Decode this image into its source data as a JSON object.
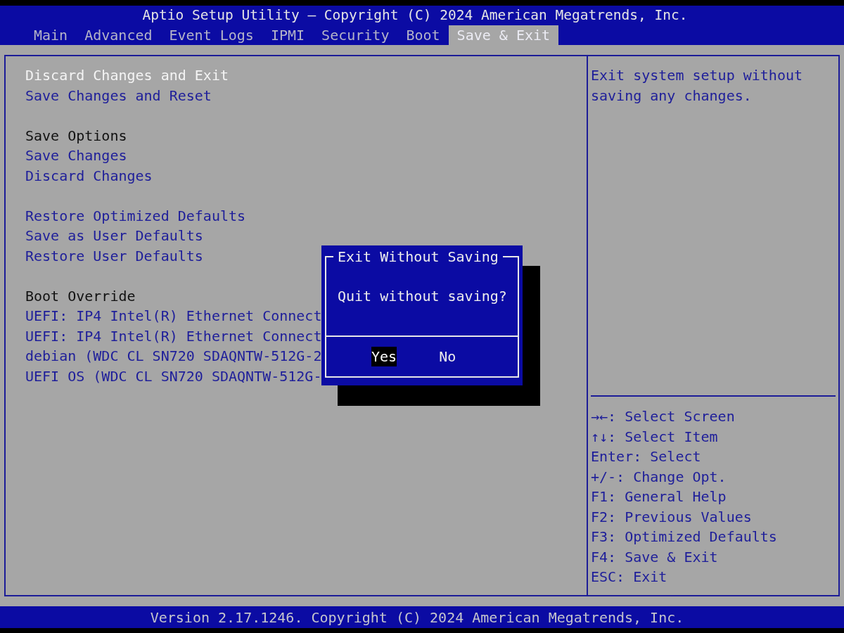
{
  "window": {
    "title": "Aptio Setup Utility – Copyright (C) 2024 American Megatrends, Inc."
  },
  "tabs": [
    {
      "label": "Main",
      "selected": false
    },
    {
      "label": "Advanced",
      "selected": false
    },
    {
      "label": "Event Logs",
      "selected": false
    },
    {
      "label": "IPMI",
      "selected": false
    },
    {
      "label": "Security",
      "selected": false
    },
    {
      "label": "Boot",
      "selected": false
    },
    {
      "label": "Save & Exit",
      "selected": true
    }
  ],
  "menu": {
    "groups": [
      {
        "items": [
          {
            "label": "Discard Changes and Exit",
            "selected": true
          },
          {
            "label": "Save Changes and Reset",
            "selected": false
          }
        ]
      },
      {
        "heading": "Save Options",
        "items": [
          {
            "label": "Save Changes",
            "selected": false
          },
          {
            "label": "Discard Changes",
            "selected": false
          }
        ]
      },
      {
        "items": [
          {
            "label": "Restore Optimized Defaults",
            "selected": false
          },
          {
            "label": "Save as User Defaults",
            "selected": false
          },
          {
            "label": "Restore User Defaults",
            "selected": false
          }
        ]
      },
      {
        "heading": "Boot Override",
        "items": [
          {
            "label": "UEFI: IP4 Intel(R) Ethernet Connect",
            "selected": false
          },
          {
            "label": "UEFI: IP4 Intel(R) Ethernet Connect",
            "selected": false
          },
          {
            "label": "debian (WDC CL SN720 SDAQNTW-512G-2",
            "selected": false
          },
          {
            "label": "UEFI OS (WDC CL SN720 SDAQNTW-512G-",
            "selected": false
          }
        ]
      }
    ]
  },
  "dialog": {
    "title": "Exit Without Saving",
    "message": "Quit without saving?",
    "buttons": [
      {
        "label": "Yes",
        "selected": true
      },
      {
        "label": "No",
        "selected": false
      }
    ]
  },
  "help": {
    "text": "Exit system setup without saving any changes.",
    "keys": [
      "→←: Select Screen",
      "↑↓: Select Item",
      "Enter: Select",
      "+/-: Change Opt.",
      "F1: General Help",
      "F2: Previous Values",
      "F3: Optimized Defaults",
      "F4: Save & Exit",
      "ESC: Exit"
    ]
  },
  "status_bar": {
    "text": "Version 2.17.1246. Copyright (C) 2024 American Megatrends, Inc."
  }
}
